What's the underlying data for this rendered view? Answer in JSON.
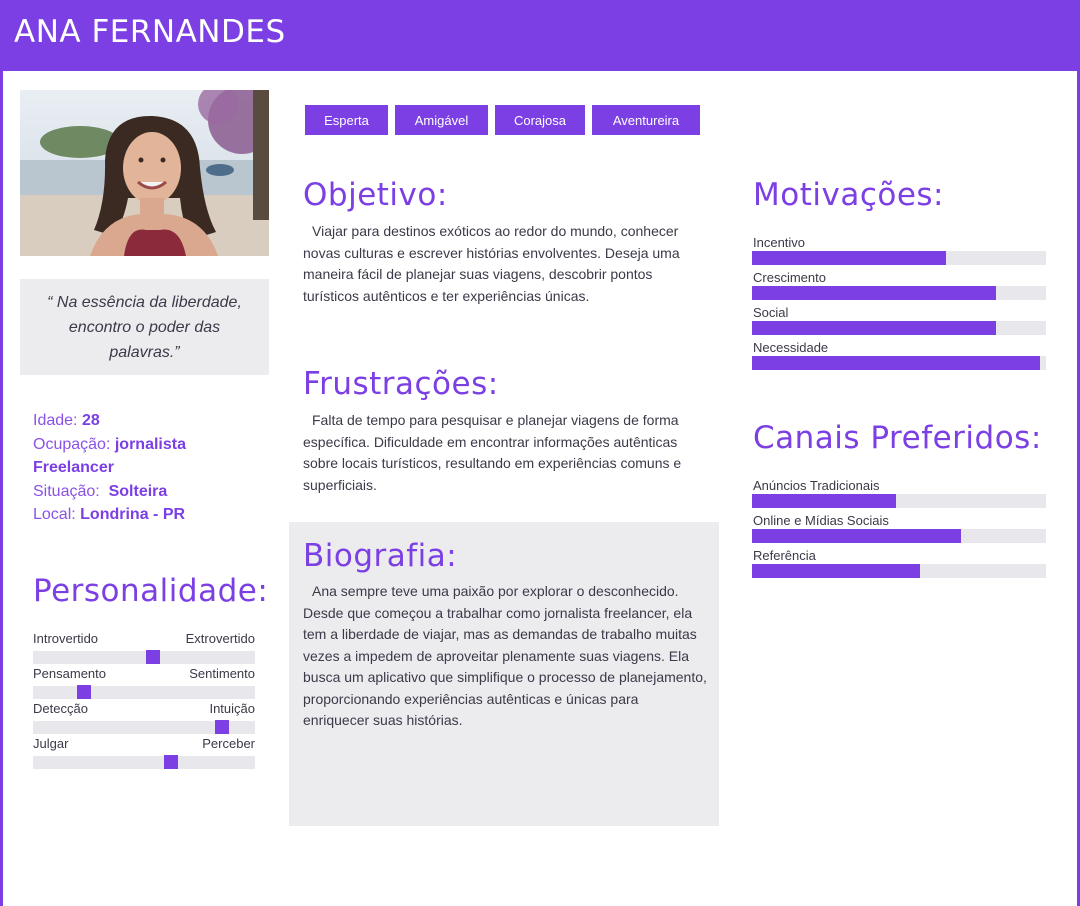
{
  "header": {
    "name": "ANA FERNANDES"
  },
  "quote": "“ Na essência da liberdade, encontro o poder das palavras.”",
  "info": {
    "age_label": "Idade:",
    "age": "28",
    "occupation_label": "Ocupação:",
    "occupation_line1": "jornalista",
    "occupation_line2": "Freelancer",
    "status_label": "Situação:",
    "status": "Solteira",
    "location_label": "Local:",
    "location": "Londrina - PR"
  },
  "tags": [
    "Esperta",
    "Amigável",
    "Corajosa",
    "Aventureira"
  ],
  "objetivo": {
    "title": "Objetivo:",
    "text": "Viajar para destinos exóticos ao redor do mundo, conhecer novas culturas e escrever histórias envolventes. Deseja uma maneira fácil de planejar suas viagens, descobrir pontos turísticos autênticos e ter experiências únicas."
  },
  "frustracoes": {
    "title": "Frustrações:",
    "text": "Falta de tempo para pesquisar e planejar viagens de forma específica. Dificuldade em encontrar informações autênticas sobre locais turísticos, resultando em experiências comuns e superficiais."
  },
  "biografia": {
    "title": "Biografia:",
    "text": "Ana sempre teve uma paixão por explorar o desconhecido. Desde que começou a trabalhar como jornalista freelancer, ela tem a liberdade de viajar, mas as demandas de trabalho muitas vezes a impedem de aproveitar plenamente suas viagens. Ela busca um aplicativo que simplifique o processo de planejamento, proporcionando experiências autênticas e únicas para enriquecer suas histórias."
  },
  "personalidade": {
    "title": "Personalidade:",
    "scales": [
      {
        "left": "Introvertido",
        "right": "Extrovertido",
        "value": 0.54
      },
      {
        "left": "Pensamento",
        "right": "Sentimento",
        "value": 0.23
      },
      {
        "left": "Detecção",
        "right": "Intuição",
        "value": 0.85
      },
      {
        "left": "Julgar",
        "right": "Perceber",
        "value": 0.62
      }
    ]
  },
  "motivacoes": {
    "title": "Motivações:",
    "items": [
      {
        "label": "Incentivo",
        "value": 0.66
      },
      {
        "label": "Crescimento",
        "value": 0.83
      },
      {
        "label": "Social",
        "value": 0.83
      },
      {
        "label": "Necessidade",
        "value": 0.98
      }
    ]
  },
  "canais": {
    "title": "Canais Preferidos:",
    "items": [
      {
        "label": "Anúncios Tradicionais",
        "value": 0.49
      },
      {
        "label": "Online e Mídias Sociais",
        "value": 0.71
      },
      {
        "label": "Referência",
        "value": 0.57
      }
    ]
  },
  "colors": {
    "accent": "#7b3fe4",
    "track": "#e7e7ec",
    "panel": "#ececef"
  }
}
